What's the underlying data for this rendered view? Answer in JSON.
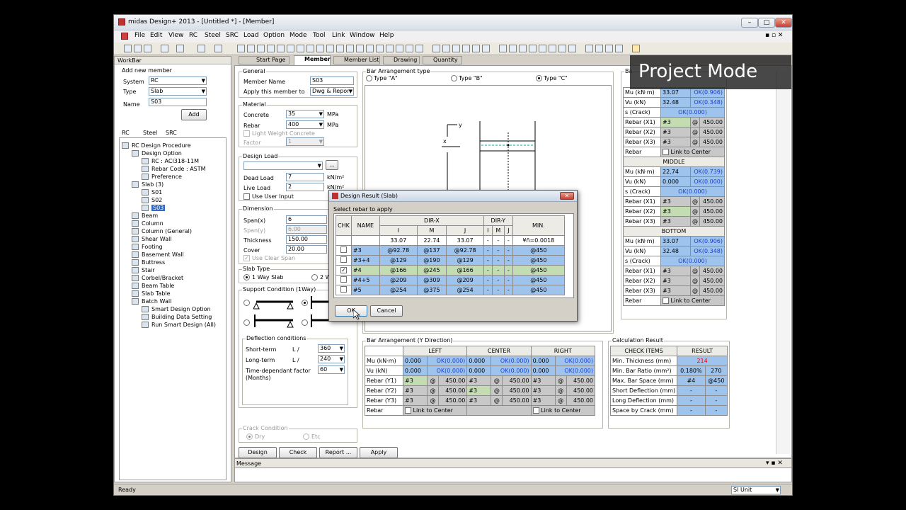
{
  "window": {
    "title": "midas Design+ 2013 - [Untitled *] - [Member]"
  },
  "menu": [
    "File",
    "Edit",
    "View",
    "Steel",
    "RC",
    "SRC",
    "Load",
    "Option",
    "Mode",
    "Tool",
    "Link",
    "Window",
    "Help"
  ],
  "overlay": {
    "text": "Project Mode"
  },
  "workbar": {
    "title": "WorkBar",
    "add_member": {
      "title": "Add new member",
      "system_label": "System",
      "system_value": "RC",
      "type_label": "Type",
      "type_value": "Slab",
      "name_label": "Name",
      "name_value": "S03",
      "add_button": "Add"
    },
    "tabs": [
      "RC",
      "Steel",
      "SRC"
    ],
    "tree": [
      "RC Design Procedure",
      "Design Option",
      "RC : ACI318-11M",
      "Rebar Code : ASTM",
      "Preference",
      "Slab (3)",
      "S01",
      "S02",
      "S03",
      "Beam",
      "Column",
      "Column (General)",
      "Shear Wall",
      "Footing",
      "Basement Wall",
      "Buttress",
      "Stair",
      "Corbel/Bracket",
      "Beam Table",
      "Slab Table",
      "Batch Wall",
      "Smart Design Option",
      "Building Data Setting",
      "Run Smart Design (All)"
    ]
  },
  "tabs": [
    "Start Page",
    "Member",
    "Member List",
    "Drawing",
    "Quantity"
  ],
  "general": {
    "title": "General",
    "member_name_label": "Member Name",
    "member_name": "S03",
    "apply_label": "Apply this member to",
    "apply_value": "Dwg & Repor"
  },
  "material": {
    "title": "Material",
    "concrete_label": "Concrete",
    "concrete_value": "35",
    "concrete_unit": "MPa",
    "rebar_label": "Rebar",
    "rebar_value": "400",
    "rebar_unit": "MPa",
    "lwc_label": "Light Weight Concrete",
    "factor_label": "Factor",
    "factor_value": "1"
  },
  "design_load": {
    "title": "Design Load",
    "dead_label": "Dead Load",
    "dead_value": "7",
    "dead_unit": "kN/m²",
    "live_label": "Live Load",
    "live_value": "2",
    "live_unit": "kN/m²",
    "user_input_label": "Use User Input"
  },
  "dimension": {
    "title": "Dimension",
    "spanx_label": "Span(x)",
    "spanx_value": "6",
    "spany_label": "Span(y)",
    "spany_value": "6.00",
    "thickness_label": "Thickness",
    "thickness_value": "150.00",
    "cover_label": "Cover",
    "cover_value": "20.00",
    "clear_span_label": "Use Clear Span"
  },
  "slab_type": {
    "title": "Slab Type",
    "one_way": "1 Way Slab",
    "two_way": "2 W"
  },
  "support": {
    "title": "Support Condition (1Way)"
  },
  "deflection": {
    "title": "Deflection conditions",
    "short_label": "Short-term",
    "short_l": "L /",
    "short_value": "360",
    "long_label": "Long-term",
    "long_l": "L /",
    "long_value": "240",
    "time_label": "Time-dependant factor",
    "time_label2": "(Months)",
    "time_value": "60"
  },
  "crack": {
    "title": "Crack Condition",
    "dry": "Dry",
    "etc": "Etc"
  },
  "actions": {
    "design": "Design",
    "check": "Check",
    "report": "Report ...",
    "apply": "Apply"
  },
  "bar_type": {
    "title": "Bar Arrangement type",
    "a": "Type \"A\"",
    "b": "Type \"B\"",
    "c": "Type \"C\""
  },
  "drawing": {
    "y": "y",
    "x": "x"
  },
  "right_panel": {
    "title_stub": "Ba",
    "rows_labels": {
      "mu": "Mu (kN·m)",
      "vu": "Vu (kN)",
      "s": "s (Crack)",
      "x1": "Rebar (X1)",
      "x2": "Rebar (X2)",
      "x3": "Rebar (X3)",
      "rebar": "Rebar",
      "link": "Link to Center",
      "at": "@"
    },
    "top": {
      "mu": "33.07",
      "mu_ok": "OK(0.906)",
      "vu": "32.48",
      "vu_ok": "OK(0.348)",
      "s": "OK(0.000)",
      "x1": "#3",
      "x1v": "450.00",
      "x2": "#3",
      "x2v": "450.00",
      "x3": "#3",
      "x3v": "450.00"
    },
    "middle_title": "MIDDLE",
    "middle": {
      "mu": "22.74",
      "mu_ok": "OK(0.739)",
      "vu": "0.000",
      "vu_ok": "OK(0.000)",
      "s": "OK(0.000)",
      "x1": "#3",
      "x1v": "450.00",
      "x2": "#3",
      "x2v": "450.00",
      "x3": "#3",
      "x3v": "450.00"
    },
    "bottom_title": "BOTTOM",
    "bottom": {
      "mu": "33.07",
      "mu_ok": "OK(0.906)",
      "vu": "32.48",
      "vu_ok": "OK(0.348)",
      "s": "OK(0.000)",
      "x1": "#3",
      "x1v": "450.00",
      "x2": "#3",
      "x2v": "450.00",
      "x3": "#3",
      "x3v": "450.00"
    }
  },
  "bar_y": {
    "title": "Bar Arrangement (Y Direction)",
    "headers": [
      "LEFT",
      "CENTER",
      "RIGHT"
    ],
    "mu_label": "Mu (kN·m)",
    "vu_label": "Vu (kN)",
    "y1_label": "Rebar (Y1)",
    "y2_label": "Rebar (Y2)",
    "y3_label": "Rebar (Y3)",
    "rebar_label": "Rebar",
    "link": "Link to Center",
    "mu": [
      "0.000",
      "OK(0.000)",
      "0.000",
      "OK(0.000)",
      "0.000",
      "OK(0.000)"
    ],
    "vu": [
      "0.000",
      "OK(0.000)",
      "0.000",
      "OK(0.000)",
      "0.000",
      "OK(0.000)"
    ],
    "bar": "#3",
    "at": "@",
    "spacing": "450.00"
  },
  "calc": {
    "title": "Calculation Result",
    "check_items": "CHECK ITEMS",
    "result": "RESULT",
    "rows": [
      {
        "item": "Min. Thickness (mm)",
        "a": "214",
        "b": ""
      },
      {
        "item": "Min. Bar Ratio (mm²)",
        "a": "0.180%",
        "b": "270"
      },
      {
        "item": "Max. Bar Space (mm)",
        "a": "#4",
        "b": "@450"
      },
      {
        "item": "Short Deflection (mm)",
        "a": "-",
        "b": "-"
      },
      {
        "item": "Long Deflection (mm)",
        "a": "-",
        "b": "-"
      },
      {
        "item": "Space by Crack (mm)",
        "a": "-",
        "b": "-"
      }
    ]
  },
  "dialog": {
    "title": "Design Result (Slab)",
    "select_label": "Select rebar to apply",
    "chk": "CHK",
    "name": "NAME",
    "dirx": "DIR-X",
    "diry": "DIR-Y",
    "min": "MIN.",
    "i": "I",
    "m": "M",
    "j": "J",
    "values": [
      "33.07",
      "22.74",
      "33.07",
      "-",
      "-",
      "-",
      "¥ñ=0.0018"
    ],
    "rows": [
      {
        "name": "#3",
        "i": "@92.78",
        "m": "@137",
        "j": "@92.78",
        "yi": "-",
        "ym": "-",
        "yj": "-",
        "min": "@450"
      },
      {
        "name": "#3+4",
        "i": "@129",
        "m": "@190",
        "j": "@129",
        "yi": "-",
        "ym": "-",
        "yj": "-",
        "min": "@450"
      },
      {
        "name": "#4",
        "i": "@166",
        "m": "@245",
        "j": "@166",
        "yi": "-",
        "ym": "-",
        "yj": "-",
        "min": "@450"
      },
      {
        "name": "#4+5",
        "i": "@209",
        "m": "@309",
        "j": "@209",
        "yi": "-",
        "ym": "-",
        "yj": "-",
        "min": "@450"
      },
      {
        "name": "#5",
        "i": "@254",
        "m": "@375",
        "j": "@254",
        "yi": "-",
        "ym": "-",
        "yj": "-",
        "min": "@450"
      }
    ],
    "ok": "OK",
    "cancel": "Cancel"
  },
  "message": {
    "title": "Message"
  },
  "status": {
    "ready": "Ready",
    "unit": "SI Unit"
  }
}
